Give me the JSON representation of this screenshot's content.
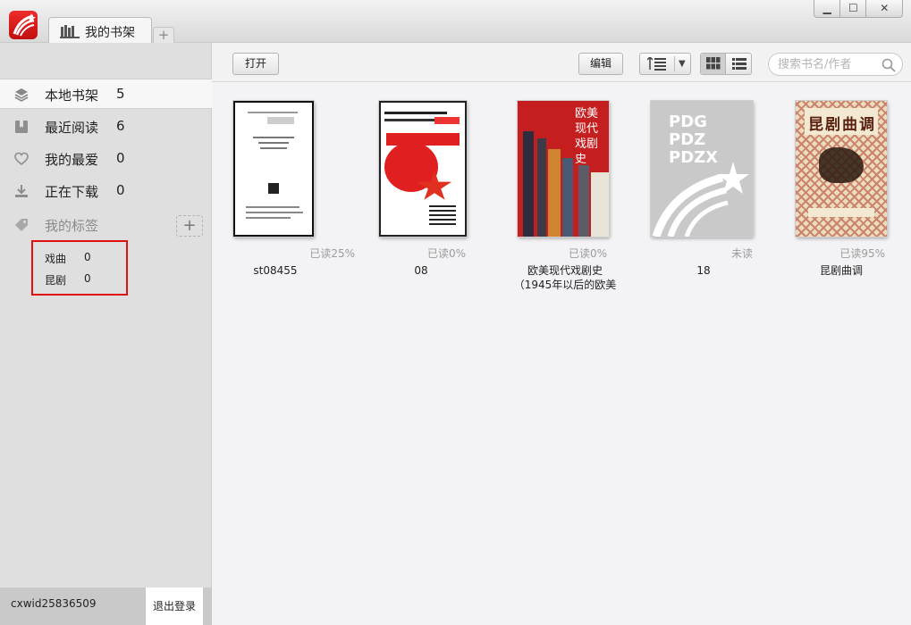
{
  "window": {
    "tab_title": "我的书架",
    "tab_add": "+",
    "controls": {
      "minimize": "▁",
      "maximize": "☐",
      "close": "✕"
    }
  },
  "sidebar": {
    "items": [
      {
        "label": "本地书架",
        "count": "5",
        "icon": "layers-icon"
      },
      {
        "label": "最近阅读",
        "count": "6",
        "icon": "bookmark-book-icon"
      },
      {
        "label": "我的最爱",
        "count": "0",
        "icon": "heart-icon"
      },
      {
        "label": "正在下载",
        "count": "0",
        "icon": "download-icon"
      }
    ],
    "tags_header": {
      "label": "我的标签",
      "add": "+",
      "icon": "tag-icon"
    },
    "tags": [
      {
        "label": "戏曲",
        "count": "0"
      },
      {
        "label": "昆剧",
        "count": "0"
      }
    ],
    "user": {
      "name": "cxwid25836509",
      "logout_label": "退出登录"
    }
  },
  "toolbar": {
    "open_label": "打开",
    "edit_label": "编辑",
    "search_placeholder": "搜索书名/作者"
  },
  "books": [
    {
      "title": "st08455",
      "progress": "已读25%"
    },
    {
      "title": "08",
      "progress": "已读0%"
    },
    {
      "title": "欧美现代戏剧史 （1945年以后的欧美",
      "progress": "已读0%",
      "cover_text": "欧美现代戏剧史"
    },
    {
      "title": "18",
      "progress": "未读",
      "cover_text": "PDG PDZ PDZX"
    },
    {
      "title": "昆剧曲调",
      "progress": "已读95%",
      "cover_text": "昆剧曲调"
    }
  ],
  "colors": {
    "accent_red": "#e01010",
    "brand_red": "#d61a1a",
    "sidebar_bg": "#dfdfdf"
  }
}
